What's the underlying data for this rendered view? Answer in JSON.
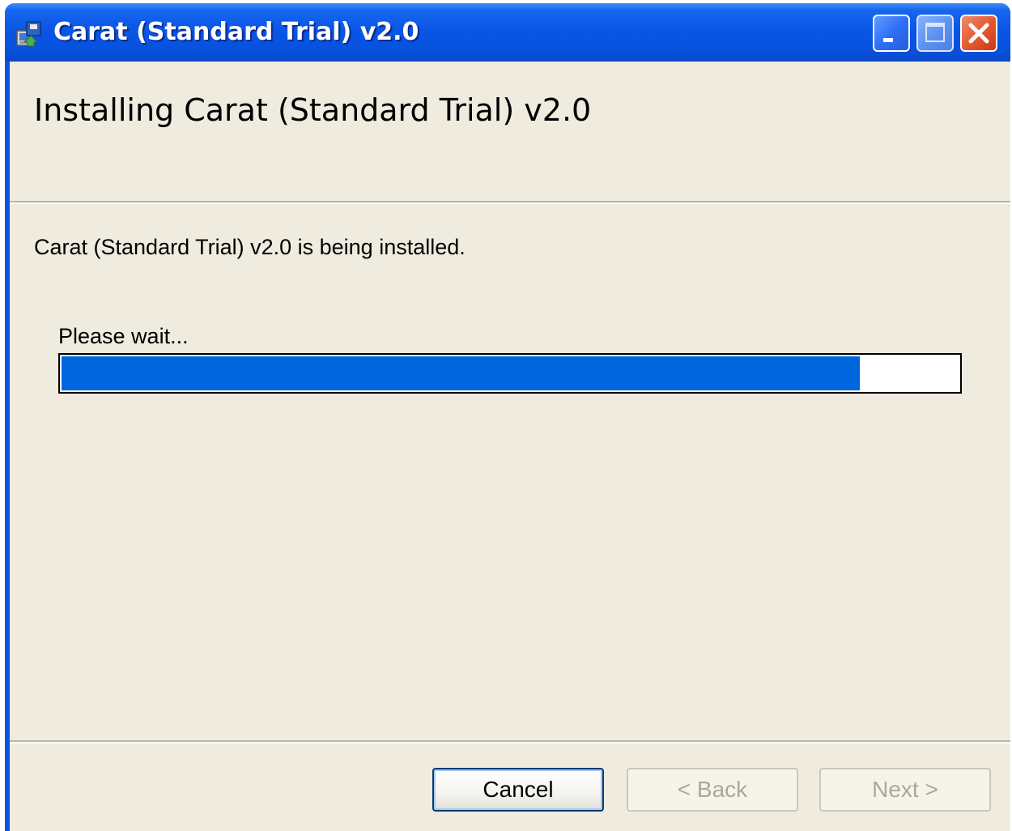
{
  "window": {
    "title": "Carat (Standard Trial) v2.0",
    "icon": "installer-icon",
    "controls": [
      "minimize-icon",
      "maximize-icon",
      "close-icon"
    ]
  },
  "banner": {
    "title": "Installing Carat (Standard Trial) v2.0"
  },
  "body": {
    "status_text": "Carat (Standard Trial) v2.0 is being installed.",
    "wait_text": "Please wait...",
    "progress": 0.89
  },
  "buttons": {
    "cancel": "Cancel",
    "back": "< Back",
    "next": "Next >"
  },
  "colors": {
    "titlebar": "#0a56e6",
    "client_bg": "#efebdf",
    "progress_fill": "#0066dd",
    "close_button": "#e45a30",
    "disabled_text": "#aca899"
  }
}
